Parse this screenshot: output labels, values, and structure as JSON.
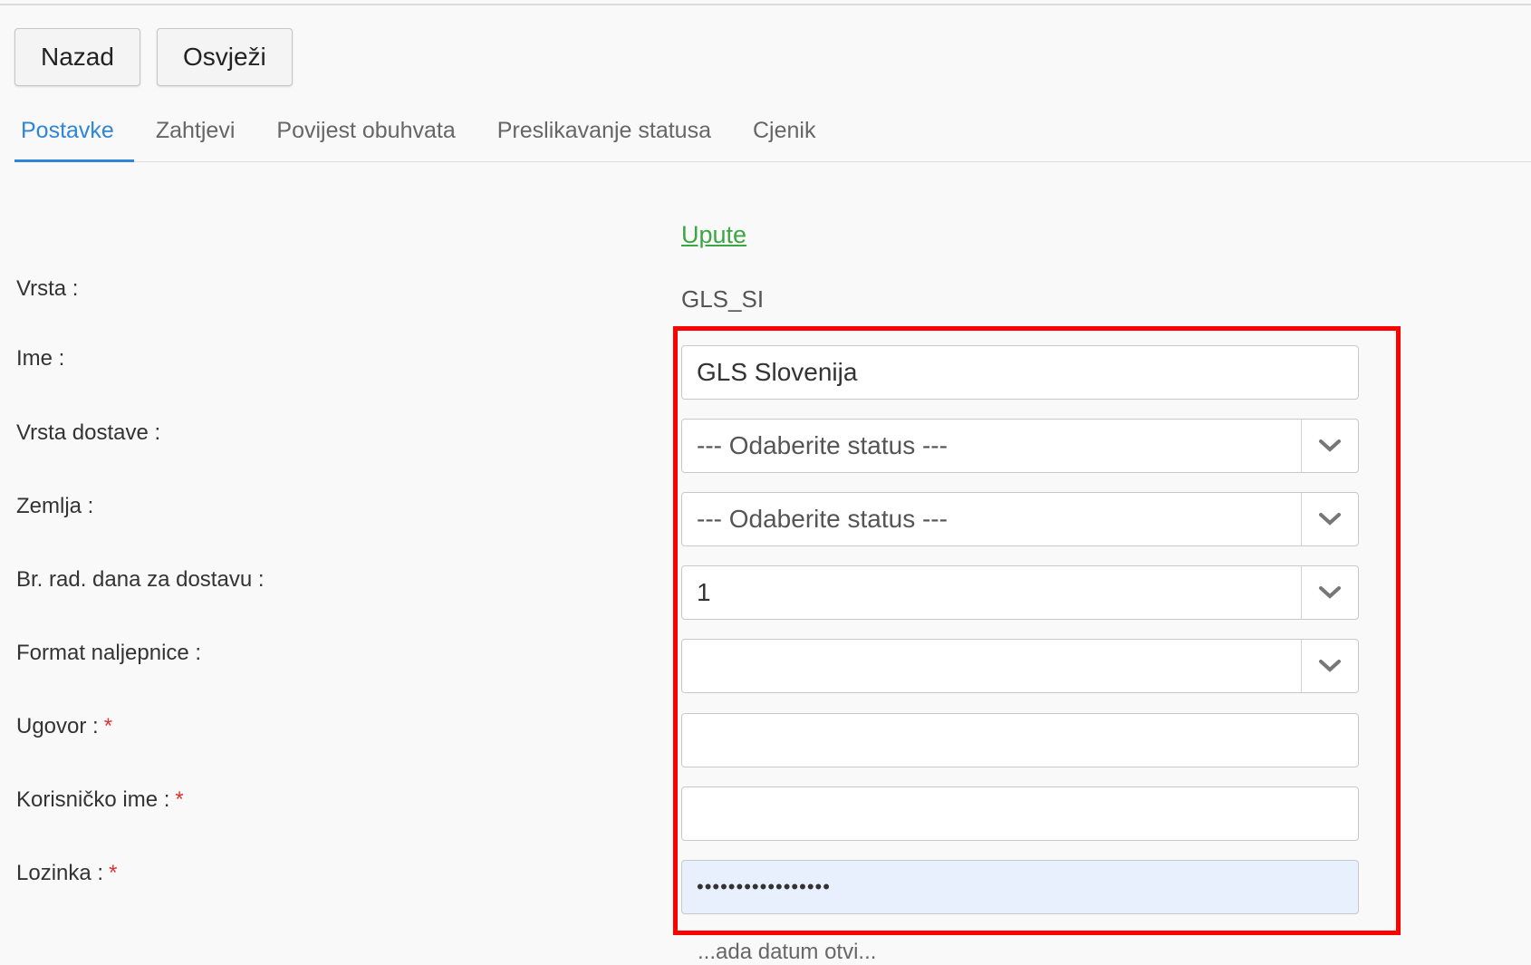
{
  "toolbar": {
    "back_label": "Nazad",
    "refresh_label": "Osvježi"
  },
  "tabs": [
    {
      "label": "Postavke",
      "active": true
    },
    {
      "label": "Zahtjevi",
      "active": false
    },
    {
      "label": "Povijest obuhvata",
      "active": false
    },
    {
      "label": "Preslikavanje statusa",
      "active": false
    },
    {
      "label": "Cjenik",
      "active": false
    }
  ],
  "form": {
    "upute_link": "Upute",
    "vrsta": {
      "label": "Vrsta :",
      "value": "GLS_SI"
    },
    "ime": {
      "label": "Ime :",
      "value": "GLS Slovenija"
    },
    "vrsta_dostave": {
      "label": "Vrsta dostave :",
      "value": "--- Odaberite status ---"
    },
    "zemlja": {
      "label": "Zemlja :",
      "value": "--- Odaberite status ---"
    },
    "br_rad_dana": {
      "label": "Br. rad. dana za dostavu :",
      "value": "1"
    },
    "format_naljepnice": {
      "label": "Format naljepnice :",
      "value": ""
    },
    "ugovor": {
      "label": "Ugovor :",
      "required": "*",
      "value": ""
    },
    "korisnicko_ime": {
      "label": "Korisničko ime :",
      "required": "*",
      "value": ""
    },
    "lozinka": {
      "label": "Lozinka :",
      "required": "*",
      "value": "•••••••••••••••••"
    },
    "partial_text": "...ada datum otvi..."
  },
  "colors": {
    "accent": "#2f86d6",
    "link": "#3aa644",
    "required": "#e0322e",
    "highlight": "#ff0000",
    "autofill": "#e8f0fe"
  }
}
